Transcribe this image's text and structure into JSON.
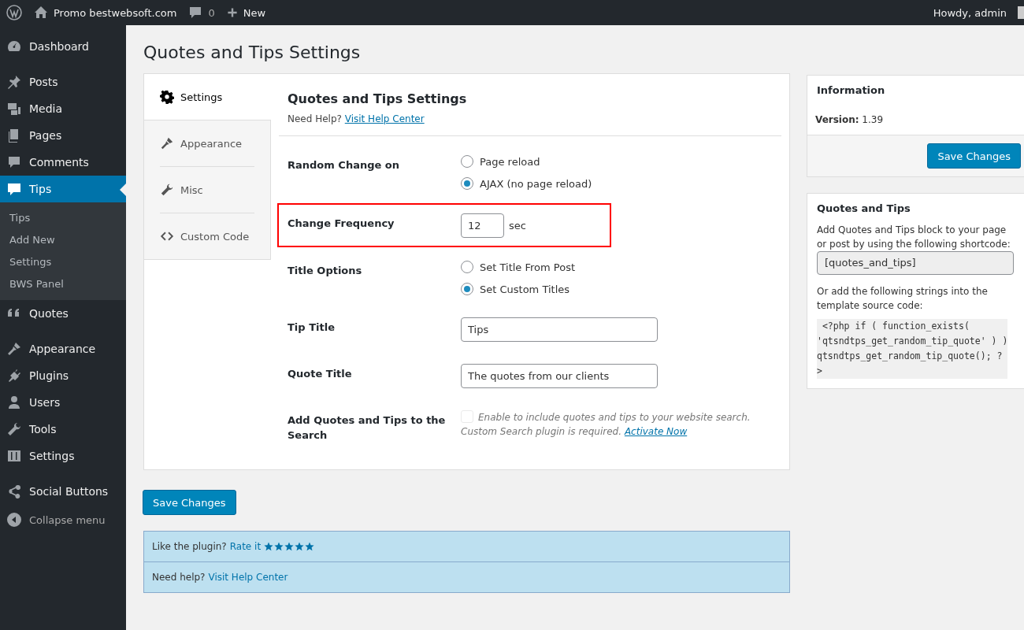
{
  "admin_bar": {
    "site_name": "Promo bestwebsoft.com",
    "comments_count": "0",
    "new_label": "New",
    "greeting": "Howdy, admin"
  },
  "sidebar": {
    "groups": [
      [
        {
          "label": "Dashboard",
          "selected": false
        }
      ],
      [
        {
          "label": "Posts",
          "selected": false
        },
        {
          "label": "Media",
          "selected": false
        },
        {
          "label": "Pages",
          "selected": false
        },
        {
          "label": "Comments",
          "selected": false
        },
        {
          "label": "Tips",
          "selected": true,
          "children": [
            "Tips",
            "Add New",
            "Settings",
            "BWS Panel"
          ]
        },
        {
          "label": "Quotes",
          "selected": false
        }
      ],
      [
        {
          "label": "Appearance",
          "selected": false
        },
        {
          "label": "Plugins",
          "selected": false
        },
        {
          "label": "Users",
          "selected": false
        },
        {
          "label": "Tools",
          "selected": false
        },
        {
          "label": "Settings",
          "selected": false
        }
      ],
      [
        {
          "label": "Social Buttons",
          "selected": false
        }
      ]
    ],
    "collapse_label": "Collapse menu"
  },
  "page_title": "Quotes and Tips Settings",
  "tabs": [
    {
      "label": "Settings",
      "selected": true
    },
    {
      "label": "Appearance",
      "selected": false
    },
    {
      "label": "Misc",
      "selected": false
    },
    {
      "label": "Custom Code",
      "selected": false
    }
  ],
  "panel": {
    "title": "Quotes and Tips Settings",
    "help_text": "Need Help?",
    "help_link": "Visit Help Center"
  },
  "rows": [
    {
      "kind": "radio",
      "label": "Random Change on",
      "highlighted": false,
      "options": [
        {
          "label": "Page reload",
          "selected": false
        },
        {
          "label": "AJAX (no page reload)",
          "selected": true
        }
      ]
    },
    {
      "kind": "number",
      "label": "Change Frequency",
      "highlighted": true,
      "value": "12",
      "unit": "sec"
    },
    {
      "kind": "radio",
      "label": "Title Options",
      "highlighted": false,
      "options": [
        {
          "label": "Set Title From Post",
          "selected": false
        },
        {
          "label": "Set Custom Titles",
          "selected": true
        }
      ]
    },
    {
      "kind": "text",
      "label": "Tip Title",
      "highlighted": false,
      "value": "Tips"
    },
    {
      "kind": "text",
      "label": "Quote Title",
      "highlighted": false,
      "value": "The quotes from our clients"
    },
    {
      "kind": "checkbox",
      "label": "Add Quotes and Tips to the Search",
      "highlighted": false,
      "checked": false,
      "disabled": true,
      "description": "Enable to include quotes and tips to your website search. Custom Search plugin is required.",
      "link": "Activate Now"
    }
  ],
  "save_button": "Save Changes",
  "notices": [
    {
      "text": "Like the plugin?",
      "link": "Rate it",
      "stars": 5
    },
    {
      "text": "Need help?",
      "link": "Visit Help Center"
    }
  ],
  "info_box": {
    "title": "Information",
    "version_label": "Version:",
    "version": "1.39",
    "button": "Save Changes"
  },
  "shortcode_box": {
    "title": "Quotes and Tips",
    "intro": "Add Quotes and Tips block to your page or post by using the following shortcode:",
    "shortcode": "[quotes_and_tips]",
    "template_intro": "Or add the following strings into the template source code:",
    "code_lines": [
      " <?php if ( function_exists(",
      "'qtsndtps_get_random_tip_quote' ) )",
      "qtsndtps_get_random_tip_quote(); ?",
      ">"
    ]
  }
}
